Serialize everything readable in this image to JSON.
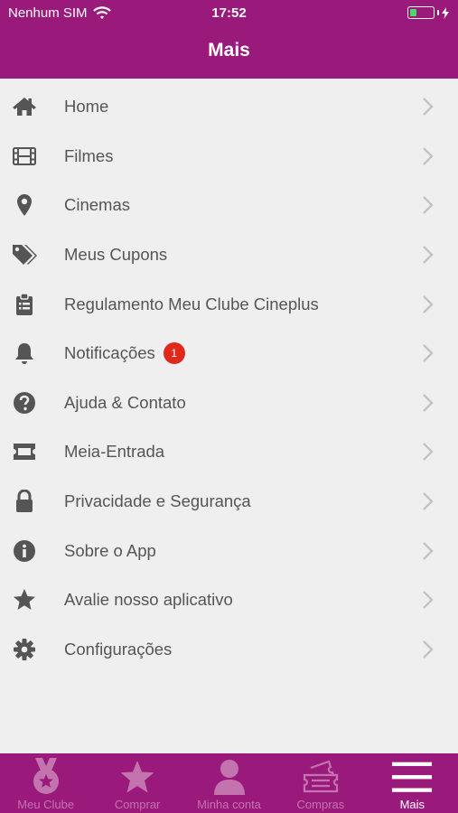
{
  "status": {
    "carrier": "Nenhum SIM",
    "time": "17:52",
    "battery_level": 0.25
  },
  "header": {
    "title": "Mais"
  },
  "menu": [
    {
      "label": "Home",
      "icon": "home-icon"
    },
    {
      "label": "Filmes",
      "icon": "film-icon"
    },
    {
      "label": "Cinemas",
      "icon": "map-pin-icon"
    },
    {
      "label": "Meus Cupons",
      "icon": "tags-icon"
    },
    {
      "label": "Regulamento Meu Clube Cineplus",
      "icon": "clipboard-icon"
    },
    {
      "label": "Notificações",
      "icon": "bell-icon",
      "badge": "1"
    },
    {
      "label": "Ajuda & Contato",
      "icon": "question-icon"
    },
    {
      "label": "Meia-Entrada",
      "icon": "ticket-icon"
    },
    {
      "label": "Privacidade e Segurança",
      "icon": "lock-icon"
    },
    {
      "label": "Sobre o App",
      "icon": "info-icon"
    },
    {
      "label": "Avalie nosso aplicativo",
      "icon": "star-icon"
    },
    {
      "label": "Configurações",
      "icon": "gear-icon"
    }
  ],
  "tabbar": [
    {
      "label": "Meu Clube",
      "icon": "medal-icon"
    },
    {
      "label": "Comprar",
      "icon": "star-icon"
    },
    {
      "label": "Minha conta",
      "icon": "user-icon"
    },
    {
      "label": "Compras",
      "icon": "tickets-icon"
    },
    {
      "label": "Mais",
      "icon": "menu-icon",
      "active": true
    }
  ],
  "colors": {
    "brand": "#9a1a7c",
    "badge": "#e0291b",
    "inactive_tab": "#c374ae"
  }
}
